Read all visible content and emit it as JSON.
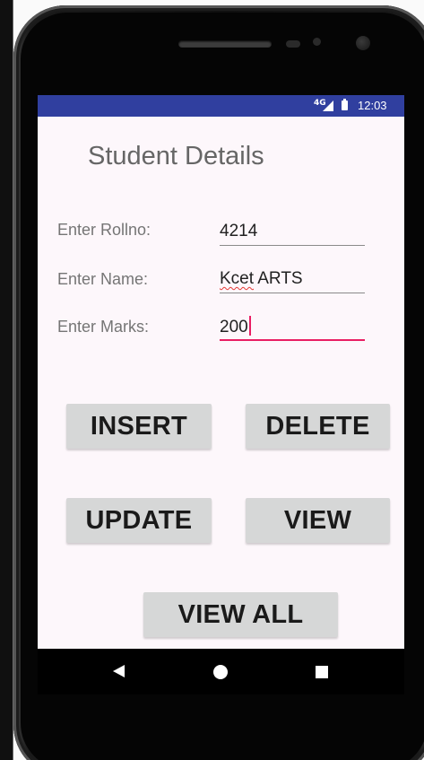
{
  "status_bar": {
    "network": "4G",
    "time": "12:03",
    "icons": [
      "signal-icon",
      "battery-icon"
    ],
    "color": "#303f9f"
  },
  "app": {
    "title": "Student Details"
  },
  "form": {
    "rollno": {
      "label": "Enter Rollno:",
      "value": "4214"
    },
    "name": {
      "label": "Enter Name:",
      "value_underlined": "Kcet",
      "value_rest": " ARTS"
    },
    "marks": {
      "label": "Enter Marks:",
      "value": "200",
      "focused": true
    }
  },
  "buttons": {
    "insert": "INSERT",
    "delete": "DELETE",
    "update": "UPDATE",
    "view": "VIEW",
    "view_all": "VIEW ALL"
  },
  "nav_bar": {
    "icons": [
      "back-icon",
      "home-icon",
      "recents-icon"
    ]
  },
  "colors": {
    "accent": "#e91e63",
    "button_bg": "#d6d7d7",
    "screen_bg": "#fdf7fb"
  }
}
